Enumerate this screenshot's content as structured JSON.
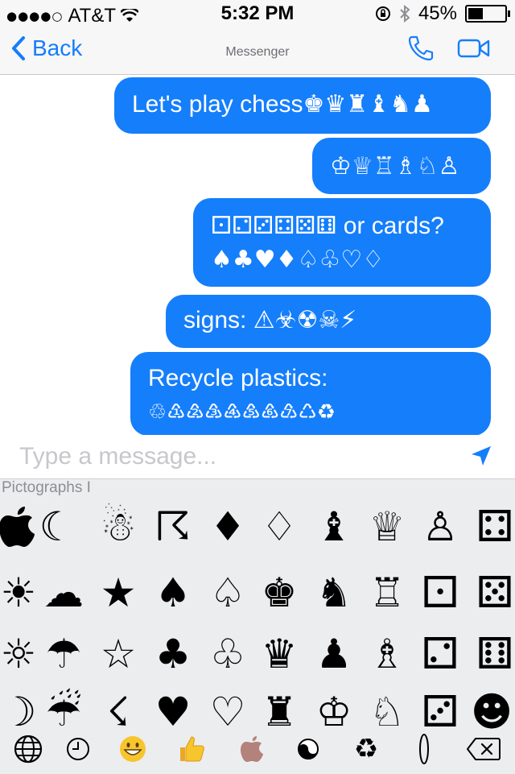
{
  "status": {
    "carrier": "AT&T",
    "time": "5:32 PM",
    "battery": "45%",
    "battery_level": 0.45
  },
  "nav": {
    "back_label": "Back",
    "subtitle": "Messenger",
    "phone_icon": "phone-icon",
    "video_icon": "video-camera-icon"
  },
  "messages": [
    {
      "lines": [
        "Let's play chess♚♛♜♝♞♟"
      ]
    },
    {
      "lines": [
        "♔♕♖♗♘♙"
      ]
    },
    {
      "lines": [
        "⚀⚁⚂⚃⚄⚅ or cards?",
        "♠♣♥♦♤♧♡♢"
      ]
    },
    {
      "lines": [
        "signs: ⚠☣☢☠⚡"
      ]
    },
    {
      "lines": [
        "Recycle plastics:",
        "♲♳♴♵♶♷♸♹♺♻"
      ]
    }
  ],
  "composer": {
    "placeholder": "Type a message..."
  },
  "keyboard": {
    "label": "Pictographs I",
    "rows": [
      [
        "",
        "☾",
        "☃",
        "☈",
        "♦",
        "♢",
        "♝",
        "♕",
        "♙",
        "⚃"
      ],
      [
        "☀",
        "☁",
        "★",
        "♠",
        "♤",
        "♚",
        "♞",
        "♖",
        "⚀",
        "⚄"
      ],
      [
        "☼",
        "☂",
        "☆",
        "♣",
        "♧",
        "♛",
        "♟",
        "♗",
        "⚁",
        "⚅"
      ],
      [
        "☽",
        "☔",
        "☇",
        "♥",
        "♡",
        "♜",
        "♔",
        "♘",
        "⚂",
        "☻"
      ]
    ],
    "bottom_keys": [
      "globe-icon",
      "clock-icon",
      "grin-emoji",
      "thumbs-up-emoji",
      "apple-icon",
      "yin-yang-icon",
      "recycle-icon",
      "zero-icon",
      "backspace-icon"
    ]
  },
  "colors": {
    "accent": "#157efb",
    "bubble": "#157efb",
    "keyboard_bg": "#ecedef"
  }
}
